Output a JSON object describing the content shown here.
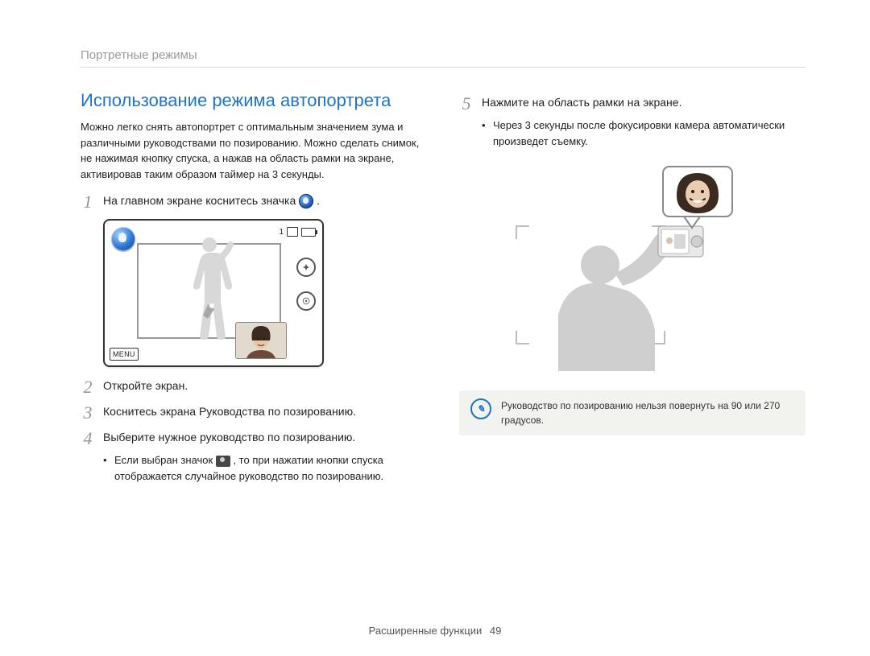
{
  "header": {
    "section": "Портретные режимы"
  },
  "left": {
    "title": "Использование режима автопортрета",
    "intro": "Можно легко снять автопортрет с оптимальным значением зума и различными руководствами по позированию. Можно сделать снимок, не нажимая кнопку спуска, а нажав на область рамки на экране, активировав таким образом таймер на 3 секунды.",
    "step1": {
      "num": "1",
      "text_before": "На главном экране коснитесь значка ",
      "text_after": " ."
    },
    "cam": {
      "count": "1",
      "menu": "MENU"
    },
    "step2": {
      "num": "2",
      "text": "Откройте экран."
    },
    "step3": {
      "num": "3",
      "text": "Коснитесь экрана Руководства по позированию."
    },
    "step4": {
      "num": "4",
      "text": "Выберите нужное руководство по позированию.",
      "bullet_before": "Если выбран значок ",
      "bullet_after": ", то при нажатии кнопки спуска отображается случайное руководство по позированию."
    }
  },
  "right": {
    "step5": {
      "num": "5",
      "text": "Нажмите на область рамки на экране.",
      "bullet": "Через 3 секунды после фокусировки камера автоматически произведет съемку."
    },
    "note": {
      "text": "Руководство по позированию нельзя повернуть на 90 или 270 градусов."
    }
  },
  "footer": {
    "label": "Расширенные функции",
    "page": "49"
  }
}
